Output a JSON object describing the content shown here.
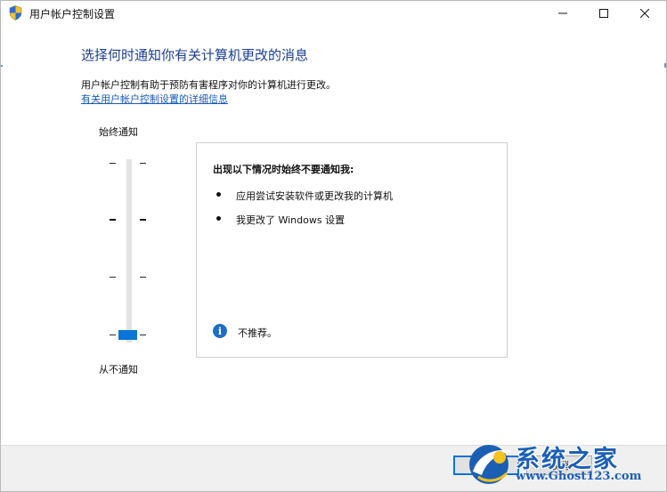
{
  "window": {
    "title": "用户帐户控制设置",
    "icon": "shield-icon",
    "controls": {
      "minimize": "minimize-icon",
      "maximize": "maximize-icon",
      "close": "close-icon"
    }
  },
  "header": {
    "heading": "选择何时通知你有关计算机更改的消息",
    "description": "用户帐户控制有助于预防有害程序对你的计算机进行更改。",
    "more_info_link": "有关用户帐户控制设置的详细信息"
  },
  "slider": {
    "top_label": "始终通知",
    "bottom_label": "从不通知",
    "levels": 4,
    "selected_level": 1
  },
  "info_panel": {
    "title": "出现以下情况时始终不要通知我:",
    "items": [
      "应用尝试安装软件或更改我的计算机",
      "我更改了 Windows 设置"
    ],
    "note_icon": "info-icon",
    "note": "不推荐。"
  },
  "footer": {
    "ok_label": "确定",
    "cancel_label": "取消"
  },
  "watermark": {
    "name": "系统之家",
    "url": "www.Ghost123.com"
  },
  "colors": {
    "heading": "#1b3f8f",
    "link": "#1a5bb5",
    "accent": "#0a74d7",
    "info": "#1f6dc4"
  }
}
